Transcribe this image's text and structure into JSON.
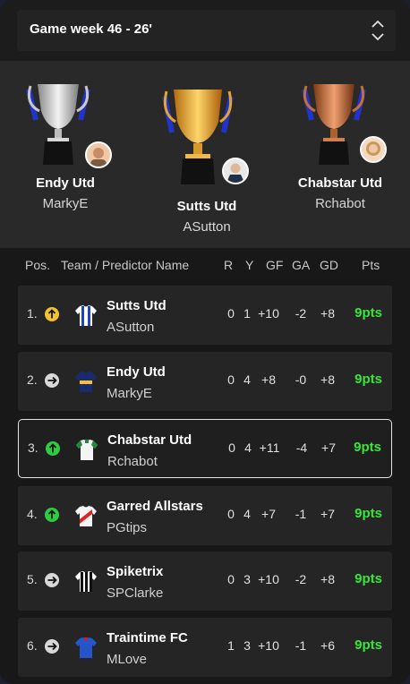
{
  "gameweek": {
    "label": "Game week 46 - 26'",
    "icon": "chevron-up-down-icon"
  },
  "podium": [
    {
      "place": 2,
      "team": "Endy Utd",
      "predictor": "MarkyE",
      "trophy": "silver"
    },
    {
      "place": 1,
      "team": "Sutts Utd",
      "predictor": "ASutton",
      "trophy": "gold"
    },
    {
      "place": 3,
      "team": "Chabstar Utd",
      "predictor": "Rchabot",
      "trophy": "bronze"
    }
  ],
  "table_header": {
    "pos": "Pos.",
    "team": "Team / Predictor Name",
    "r": "R",
    "y": "Y",
    "gf": "GF",
    "ga": "GA",
    "gd": "GD",
    "pts": "Pts"
  },
  "rows": [
    {
      "pos": "1.",
      "movement": "up",
      "movement_color": "#f2c230",
      "team": "Sutts Utd",
      "predictor": "ASutton",
      "r": "0",
      "y": "1",
      "gf": "+10",
      "ga": "-2",
      "gd": "+8",
      "pts": "9pts",
      "shirt": "blue-white-stripes"
    },
    {
      "pos": "2.",
      "movement": "same",
      "movement_color": "#d8d8d8",
      "team": "Endy Utd",
      "predictor": "MarkyE",
      "r": "0",
      "y": "4",
      "gf": "+8",
      "ga": "-0",
      "gd": "+8",
      "pts": "9pts",
      "shirt": "navy-yellow"
    },
    {
      "pos": "3.",
      "movement": "up",
      "movement_color": "#2ecc40",
      "team": "Chabstar Utd",
      "predictor": "Rchabot",
      "r": "0",
      "y": "4",
      "gf": "+11",
      "ga": "-4",
      "gd": "+7",
      "pts": "9pts",
      "shirt": "white-green"
    },
    {
      "pos": "4.",
      "movement": "up",
      "movement_color": "#2ecc40",
      "team": "Garred Allstars",
      "predictor": "PGtips",
      "r": "0",
      "y": "4",
      "gf": "+7",
      "ga": "-1",
      "gd": "+7",
      "pts": "9pts",
      "shirt": "white-red-sash"
    },
    {
      "pos": "5.",
      "movement": "same",
      "movement_color": "#d8d8d8",
      "team": "Spiketrix",
      "predictor": "SPClarke",
      "r": "0",
      "y": "3",
      "gf": "+10",
      "ga": "-2",
      "gd": "+8",
      "pts": "9pts",
      "shirt": "black-white-stripes"
    },
    {
      "pos": "6.",
      "movement": "same",
      "movement_color": "#d8d8d8",
      "team": "Traintime FC",
      "predictor": "MLove",
      "r": "1",
      "y": "3",
      "gf": "+10",
      "ga": "-1",
      "gd": "+6",
      "pts": "9pts",
      "shirt": "blue"
    }
  ],
  "colors": {
    "points": "#39e639",
    "background": "#181818",
    "row": "#252525"
  }
}
